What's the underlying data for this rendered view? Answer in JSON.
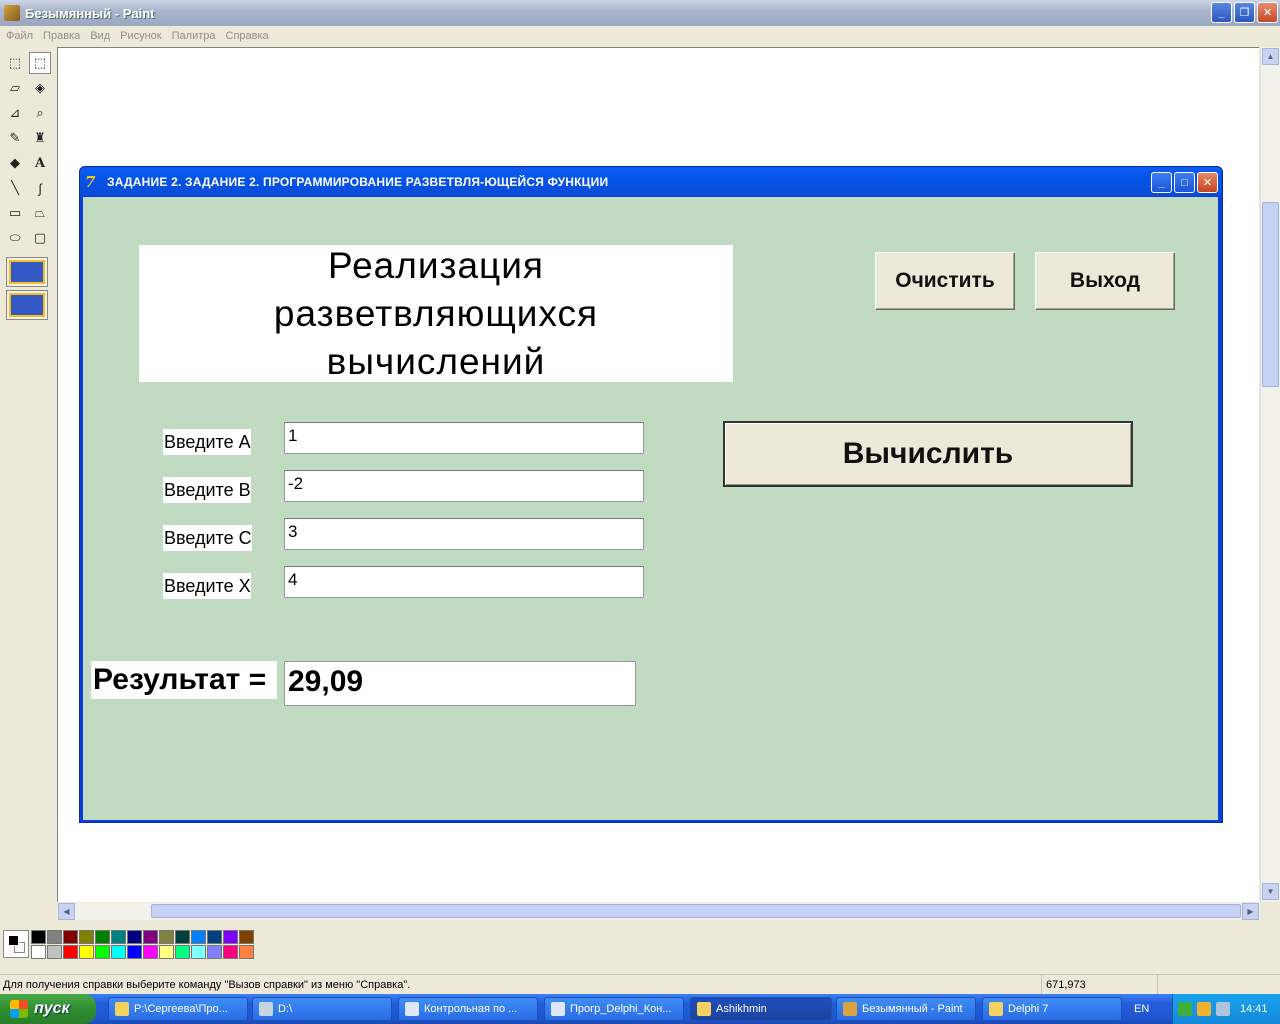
{
  "window": {
    "title": "Безымянный - Paint",
    "controls": {
      "minimize": "_",
      "maximize": "❐",
      "close": "✕"
    }
  },
  "menu": [
    "Файл",
    "Правка",
    "Вид",
    "Рисунок",
    "Палитра",
    "Справка"
  ],
  "tools": [
    {
      "name": "free-select-icon",
      "glyph": "⬚"
    },
    {
      "name": "rect-select-icon",
      "glyph": "⬚"
    },
    {
      "name": "eraser-icon",
      "glyph": "▱"
    },
    {
      "name": "fill-icon",
      "glyph": "◈"
    },
    {
      "name": "color-picker-icon",
      "glyph": "⊿"
    },
    {
      "name": "magnifier-icon",
      "glyph": "⌕"
    },
    {
      "name": "pencil-icon",
      "glyph": "✎"
    },
    {
      "name": "brush-icon",
      "glyph": "♜"
    },
    {
      "name": "airbrush-icon",
      "glyph": "◆"
    },
    {
      "name": "text-icon",
      "glyph": "A"
    },
    {
      "name": "line-icon",
      "glyph": "╲"
    },
    {
      "name": "curve-icon",
      "glyph": "∫"
    },
    {
      "name": "rectangle-icon",
      "glyph": "▭"
    },
    {
      "name": "polygon-icon",
      "glyph": "⏢"
    },
    {
      "name": "ellipse-icon",
      "glyph": "⬭"
    },
    {
      "name": "rounded-rect-icon",
      "glyph": "▢"
    }
  ],
  "palette": {
    "foreground": "#000000",
    "background": "#ffffff",
    "colors": [
      "#000000",
      "#808080",
      "#800000",
      "#808000",
      "#008000",
      "#008080",
      "#000080",
      "#800080",
      "#808040",
      "#004040",
      "#0080ff",
      "#004080",
      "#8000ff",
      "#804000",
      "#ffffff",
      "#c0c0c0",
      "#ff0000",
      "#ffff00",
      "#00ff00",
      "#00ffff",
      "#0000ff",
      "#ff00ff",
      "#ffff80",
      "#00ff80",
      "#80ffff",
      "#8080ff",
      "#ff0080",
      "#ff8040"
    ]
  },
  "statusbar": {
    "help": "Для получения справки выберите команду \"Вызов справки\" из меню \"Справка\".",
    "coords": "671,973"
  },
  "taskbar": {
    "start_label": "пуск",
    "tasks": [
      {
        "label": "P:\\Сергеева\\Про..."
      },
      {
        "label": "D:\\"
      },
      {
        "label": "Контрольная по ..."
      },
      {
        "label": "Прогр_Delphi_Кон..."
      },
      {
        "label": "Ashikhmin"
      },
      {
        "label": "Безымянный - Paint"
      },
      {
        "label": "Delphi 7"
      }
    ],
    "lang": "EN",
    "clock": "14:41"
  },
  "app": {
    "icon_glyph": "7",
    "title": "ЗАДАНИЕ 2. ЗАДАНИЕ 2. ПРОГРАММИРОВАНИЕ РАЗВЕТВЛЯ-ЮЩЕЙСЯ ФУНКЦИИ",
    "controls": {
      "minimize": "_",
      "maximize": "□",
      "close": "✕"
    },
    "heading": [
      "Реализация",
      "разветвляющихся",
      "вычислений"
    ],
    "buttons": {
      "clear": "Очистить",
      "exit": "Выход",
      "calc": "Вычислить"
    },
    "fields": [
      {
        "label": "Введите А",
        "value": "1"
      },
      {
        "label": "Введите В",
        "value": "-2"
      },
      {
        "label": "Введите С",
        "value": "3"
      },
      {
        "label": "Введите Х",
        "value": "4"
      }
    ],
    "result": {
      "label": "Результат =",
      "value": "29,09"
    }
  }
}
